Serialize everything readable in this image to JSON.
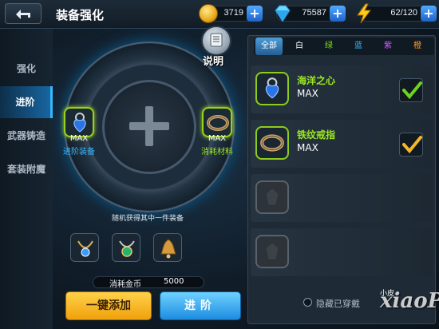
{
  "header": {
    "title": "装备强化",
    "coins": "3719",
    "diamonds": "75587",
    "energy": "62/120"
  },
  "tabs": [
    {
      "label": "强化"
    },
    {
      "label": "进阶"
    },
    {
      "label": "武器铸造"
    },
    {
      "label": "套装附魔"
    }
  ],
  "main": {
    "info_label": "说明",
    "slot_left": {
      "level": "MAX",
      "label": "进阶装备"
    },
    "slot_right": {
      "level": "MAX",
      "label": "消耗材料"
    },
    "random_hint": "随机获得其中一件装备",
    "cost_label": "消耗金币",
    "cost_value": "5000",
    "btn_add": "一键添加",
    "btn_advance": "进阶"
  },
  "filter_tabs": [
    {
      "label": "全部",
      "color": "#ffffff"
    },
    {
      "label": "白",
      "color": "#ffffff"
    },
    {
      "label": "绿",
      "color": "#86e01e"
    },
    {
      "label": "蓝",
      "color": "#3db8ff"
    },
    {
      "label": "紫",
      "color": "#d05cff"
    },
    {
      "label": "橙",
      "color": "#ff9c2a"
    }
  ],
  "items": [
    {
      "name": "海洋之心",
      "level": "MAX",
      "check_color": "#6bd41c"
    },
    {
      "name": "铁纹戒指",
      "level": "MAX",
      "check_color": "#f5b629"
    }
  ],
  "footer": {
    "hide_label": "隐藏已穿戴",
    "watermark": "xiaoPi",
    "watermark_small": "小皮"
  },
  "colors": {
    "accent": "#35b9ff",
    "border_green": "#97d21c"
  }
}
